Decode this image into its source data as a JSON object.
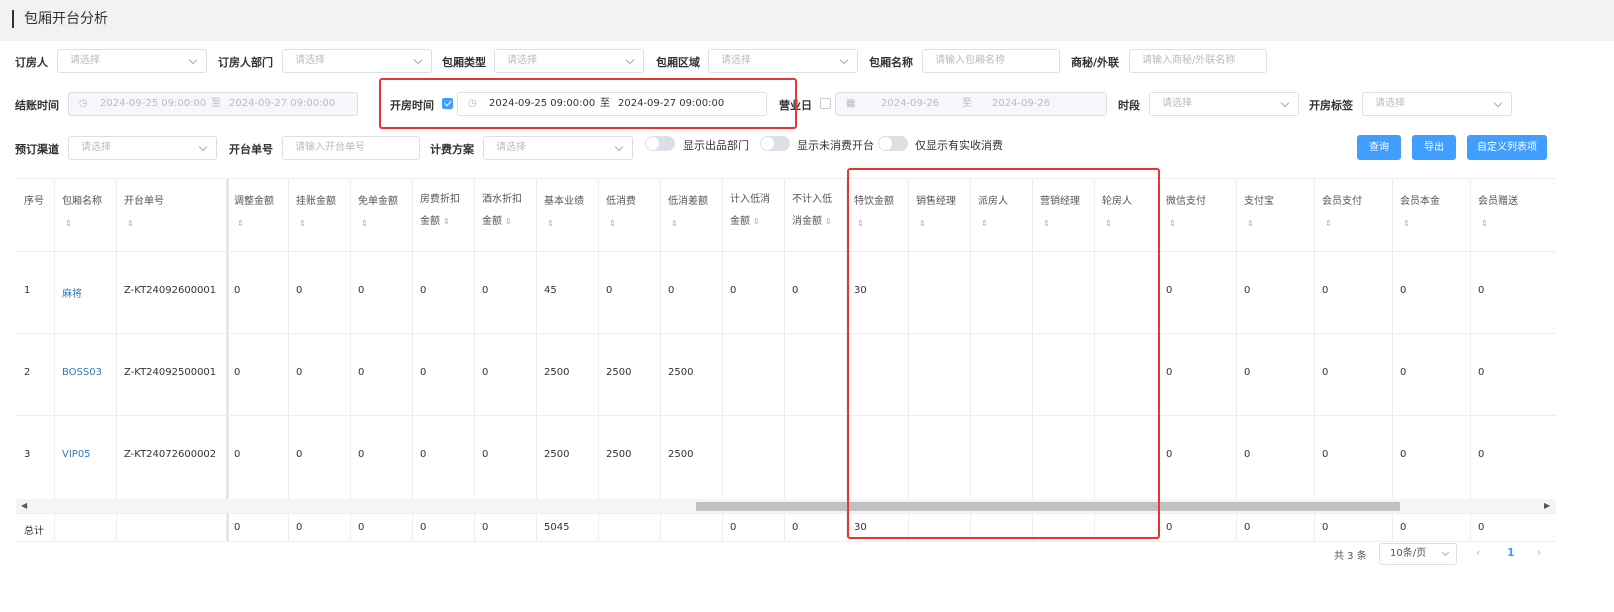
{
  "page": {
    "title": "包厢开台分析"
  },
  "filters": {
    "row1": [
      {
        "label": "订房人",
        "placeholder": "请选择"
      },
      {
        "label": "订房人部门",
        "placeholder": "请选择"
      },
      {
        "label": "包厢类型",
        "placeholder": "请选择"
      },
      {
        "label": "包厢区域",
        "placeholder": "请选择"
      },
      {
        "label": "包厢名称",
        "placeholder": "请输入包厢名称"
      },
      {
        "label": "商秘/外联",
        "placeholder": "请输入商秘/外联名称"
      }
    ],
    "checkout": {
      "label": "结账时间",
      "start": "2024-09-25 09:00:00",
      "sep": "至",
      "end": "2024-09-27 09:00:00"
    },
    "open_time": {
      "label": "开房时间",
      "start": "2024-09-25 09:00:00",
      "sep": "至",
      "end": "2024-09-27 09:00:00",
      "checked": true
    },
    "business_day": {
      "label": "营业日",
      "start": "2024-09-26",
      "sep": "至",
      "end": "2024-09-26",
      "checked": false
    },
    "period": {
      "label": "时段",
      "placeholder": "请选择"
    },
    "room_tag": {
      "label": "开房标签",
      "placeholder": "请选择"
    },
    "channel": {
      "label": "预订渠道",
      "placeholder": "请选择"
    },
    "order_no": {
      "label": "开台单号",
      "placeholder": "请输入开台单号"
    },
    "billing": {
      "label": "计费方案",
      "placeholder": "请选择"
    },
    "toggles": [
      {
        "label": "显示出品部门",
        "on": false
      },
      {
        "label": "显示未消费开台",
        "on": false
      },
      {
        "label": "仅显示有实收消费",
        "on": false
      }
    ],
    "buttons": {
      "query": "查询",
      "export": "导出",
      "custom": "自定义列表项"
    }
  },
  "table": {
    "columns": [
      {
        "label": "序号",
        "label2": "",
        "sort": false
      },
      {
        "label": "包厢名称",
        "label2": "",
        "sort": true
      },
      {
        "label": "开台单号",
        "label2": "",
        "sort": true
      },
      {
        "label": "调整金额",
        "label2": "",
        "sort": true
      },
      {
        "label": "挂账金额",
        "label2": "",
        "sort": true
      },
      {
        "label": "免单金额",
        "label2": "",
        "sort": true
      },
      {
        "label": "房费折扣",
        "label2": "金额",
        "sort": true
      },
      {
        "label": "酒水折扣",
        "label2": "金额",
        "sort": true
      },
      {
        "label": "基本业绩",
        "label2": "",
        "sort": true
      },
      {
        "label": "低消费",
        "label2": "",
        "sort": true
      },
      {
        "label": "低消差额",
        "label2": "",
        "sort": true
      },
      {
        "label": "计入低消",
        "label2": "金额",
        "sort": true
      },
      {
        "label": "不计入低",
        "label2": "消金额",
        "sort": true
      },
      {
        "label": "特饮金额",
        "label2": "",
        "sort": true
      },
      {
        "label": "销售经理",
        "label2": "",
        "sort": true
      },
      {
        "label": "派房人",
        "label2": "",
        "sort": true
      },
      {
        "label": "营销经理",
        "label2": "",
        "sort": true
      },
      {
        "label": "轮房人",
        "label2": "",
        "sort": true
      },
      {
        "label": "微信支付",
        "label2": "",
        "sort": true
      },
      {
        "label": "支付宝",
        "label2": "",
        "sort": true
      },
      {
        "label": "会员支付",
        "label2": "",
        "sort": true
      },
      {
        "label": "会员本金",
        "label2": "",
        "sort": true
      },
      {
        "label": "会员赠送",
        "label2": "",
        "sort": true
      }
    ],
    "rows": [
      [
        "1",
        "麻将",
        "Z-KT24092600001",
        "0",
        "0",
        "0",
        "0",
        "0",
        "45",
        "0",
        "0",
        "0",
        "0",
        "30",
        "",
        "",
        "",
        "",
        "0",
        "0",
        "0",
        "0",
        "0"
      ],
      [
        "2",
        "BOSS03",
        "Z-KT24092500001",
        "0",
        "0",
        "0",
        "0",
        "0",
        "2500",
        "2500",
        "2500",
        "",
        "",
        "",
        "",
        "",
        "",
        "",
        "0",
        "0",
        "0",
        "0",
        "0"
      ],
      [
        "3",
        "VIP05",
        "Z-KT24072600002",
        "0",
        "0",
        "0",
        "0",
        "0",
        "2500",
        "2500",
        "2500",
        "",
        "",
        "",
        "",
        "",
        "",
        "",
        "0",
        "0",
        "0",
        "0",
        "0"
      ]
    ],
    "footer": [
      "总计",
      "",
      "",
      "0",
      "0",
      "0",
      "0",
      "0",
      "5045",
      "",
      "",
      "0",
      "0",
      "30",
      "",
      "",
      "",
      "",
      "0",
      "0",
      "0",
      "0",
      "0"
    ]
  },
  "pager": {
    "total": "共 3 条",
    "size": "10条/页",
    "page": "1"
  },
  "colors": {
    "accent": "#409eff",
    "highlight": "#e8362f",
    "link": "#337ab7"
  }
}
